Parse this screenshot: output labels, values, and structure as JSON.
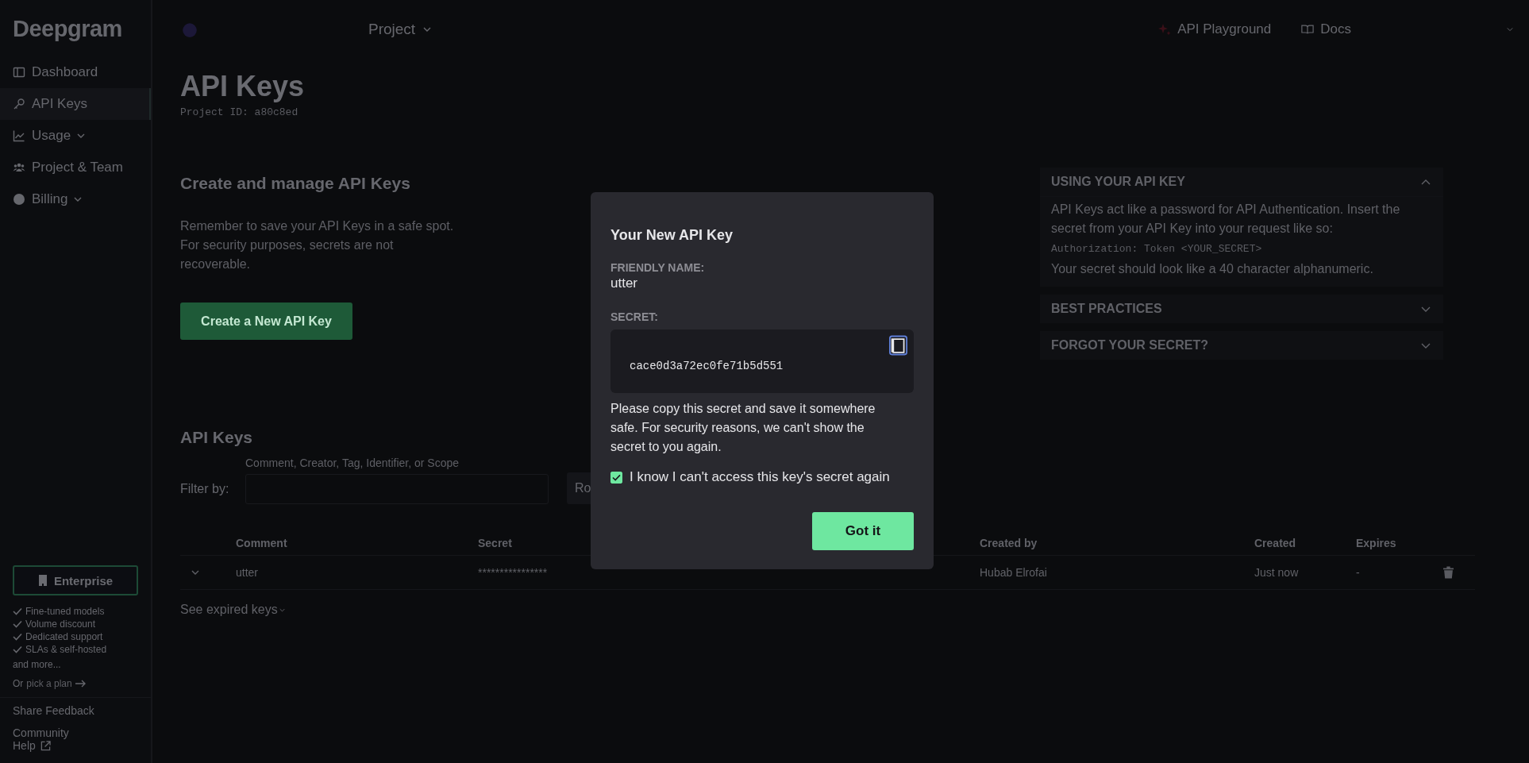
{
  "sidebar": {
    "logo": "Deepgram",
    "items": [
      {
        "label": "Dashboard",
        "selected": false,
        "has_menu": false
      },
      {
        "label": "API Keys",
        "selected": true,
        "has_menu": false
      },
      {
        "label": "Usage",
        "selected": false,
        "has_menu": true
      },
      {
        "label": "Project & Team",
        "selected": false,
        "has_menu": false
      },
      {
        "label": "Billing",
        "selected": false,
        "has_menu": true
      }
    ],
    "enterprise": {
      "button": "Enterprise",
      "features": [
        "Fine-tuned models",
        "Volume discount",
        "Dedicated support",
        "SLAs & self-hosted"
      ],
      "more": "and more...",
      "plan_prefix": "Or",
      "plan_link": "pick a plan"
    },
    "footer": [
      "Share Feedback",
      "Community",
      "Help"
    ]
  },
  "header": {
    "project": "Project",
    "links": [
      "API Playground",
      "Docs"
    ]
  },
  "page": {
    "title": "API Keys",
    "project_id": "Project ID: a80c8ed",
    "create": {
      "heading": "Create and manage API Keys",
      "text": "Remember to save your API Keys in a safe spot. For security purposes, secrets are not recoverable.",
      "button": "Create a New API Key"
    },
    "keys": {
      "heading": "API Keys",
      "filter_label": "Filter by:",
      "filter_hint": "Comment, Creator, Tag, Identifier, or Scope",
      "second_button": "Ro",
      "columns": [
        "Comment",
        "Secret",
        "Created by",
        "Created",
        "Expires"
      ],
      "rows": [
        {
          "comment": "utter",
          "secret": "****************",
          "created_by": "Hubab Elrofai",
          "created": "Just now",
          "expires": "-"
        }
      ],
      "expired_link": "See expired keys"
    }
  },
  "help_panel": {
    "sections": [
      {
        "title": "USING YOUR API KEY",
        "expanded": true,
        "body": [
          {
            "kind": "text",
            "text": "API Keys act like a password for API Authentication. Insert the secret from your API Key into your request like so:"
          },
          {
            "kind": "code",
            "text": "Authorization: Token <YOUR_SECRET>"
          },
          {
            "kind": "text",
            "text": "Your secret should look like a 40 character alphanumeric."
          }
        ]
      },
      {
        "title": "BEST PRACTICES",
        "expanded": false
      },
      {
        "title": "FORGOT YOUR SECRET?",
        "expanded": false
      }
    ]
  },
  "modal": {
    "title": "Your New API Key",
    "name_label": "FRIENDLY NAME:",
    "name": "utter",
    "secret_label": "SECRET:",
    "secret": "cace0d3a72ec0fe71b5d551",
    "notice": "Please copy this secret and save it somewhere safe. For security reasons, we can't show the secret to you again.",
    "checkbox": {
      "label": "I know I can't access this key's secret again",
      "checked": true
    },
    "button": "Got it"
  }
}
